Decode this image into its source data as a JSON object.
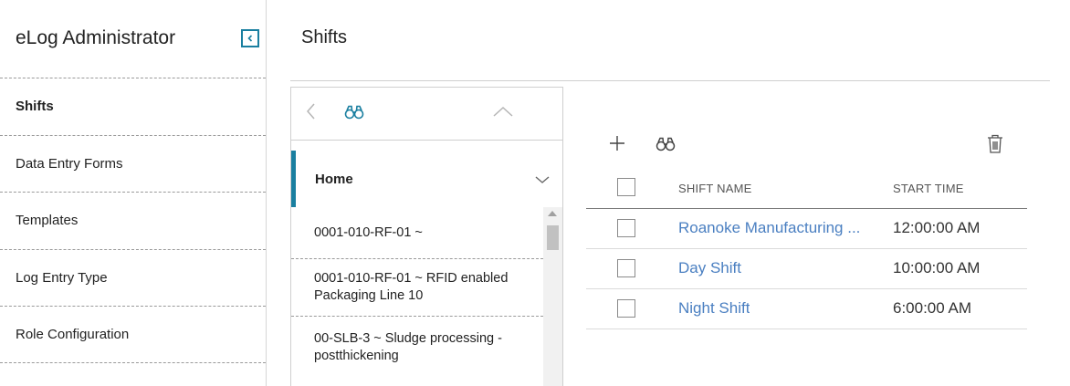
{
  "sidebar": {
    "title": "eLog Administrator",
    "items": [
      {
        "label": "Shifts",
        "active": true
      },
      {
        "label": "Data Entry Forms",
        "active": false
      },
      {
        "label": "Templates",
        "active": false
      },
      {
        "label": "Log Entry Type",
        "active": false
      },
      {
        "label": "Role Configuration",
        "active": false
      }
    ]
  },
  "header": {
    "title": "Shifts"
  },
  "tree": {
    "home_label": "Home",
    "items": [
      {
        "label": "0001-010-RF-01 ~"
      },
      {
        "label": "0001-010-RF-01 ~ RFID enabled Packaging Line 10"
      },
      {
        "label": "00-SLB-3 ~ Sludge processing - postthickening"
      }
    ]
  },
  "grid": {
    "columns": {
      "name": "SHIFT NAME",
      "start": "START TIME"
    },
    "rows": [
      {
        "name": "Roanoke Manufacturing ...",
        "start": "12:00:00 AM"
      },
      {
        "name": "Day Shift",
        "start": "10:00:00 AM"
      },
      {
        "name": "Night Shift",
        "start": "6:00:00 AM"
      }
    ]
  },
  "colors": {
    "accent": "#1a7fa0",
    "link": "#4a7fc1"
  },
  "icons": {
    "collapse": "chevron-left-box-icon",
    "back": "chevron-left-icon",
    "search": "binoculars-icon",
    "up": "chevron-up-icon",
    "expand": "chevron-down-icon",
    "add": "plus-icon",
    "delete": "trash-icon"
  }
}
